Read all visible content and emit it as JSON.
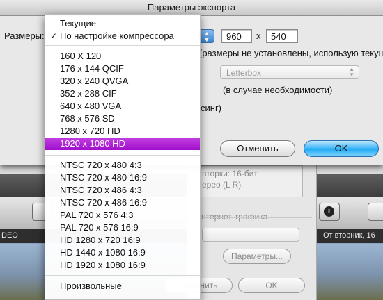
{
  "dialog": {
    "title": "Параметры экспорта",
    "size_label": "Размеры:",
    "width_value": "960",
    "times_sign": "x",
    "height_value": "540",
    "hint_text": "(размеры не установлены, использую текущие)",
    "letterbox_value": "Letterbox",
    "if_needed_text": "(в случае необходимости)",
    "deinterlace_tail": "синг)",
    "cancel_label": "Отменить",
    "ok_label": "OK"
  },
  "size_menu": {
    "items": [
      {
        "label": "Текущие"
      },
      {
        "label": "По настройке компрессора",
        "checked": true
      },
      {
        "label": "160 X 120"
      },
      {
        "label": "176 x 144 QCIF"
      },
      {
        "label": "320 x 240 QVGA"
      },
      {
        "label": "352 x 288 CIF"
      },
      {
        "label": "640 x 480 VGA"
      },
      {
        "label": "768 x 576 SD"
      },
      {
        "label": "1280 x 720 HD"
      },
      {
        "label": "1920 x 1080 HD",
        "selected": true
      },
      {
        "label": "NTSC 720 x 480 4:3"
      },
      {
        "label": "NTSC 720 x 480 16:9"
      },
      {
        "label": "NTSC 720 x 486 4:3"
      },
      {
        "label": "NTSC 720 x 486 16:9"
      },
      {
        "label": "PAL 720 x 576 4:3"
      },
      {
        "label": "PAL 720 x 576 16:9"
      },
      {
        "label": "HD 1280 x 720 16:9"
      },
      {
        "label": "HD 1440 x 1080 16:9"
      },
      {
        "label": "HD 1920 x 1080 16:9"
      },
      {
        "label": "Произвольные"
      }
    ],
    "check_glyph": "✓",
    "selected_color": "#b325d8"
  },
  "background": {
    "audio_line1": "вторки: 16-бит",
    "audio_line2": "ерео (L R)",
    "internet_section": "нтернет-трафика",
    "params_button": "Параметры...",
    "cancel_button": "Отменить",
    "ok_button": "OK",
    "strip_left": "DEO",
    "strip_right": "От вторник, 16",
    "info_icon": "i"
  }
}
